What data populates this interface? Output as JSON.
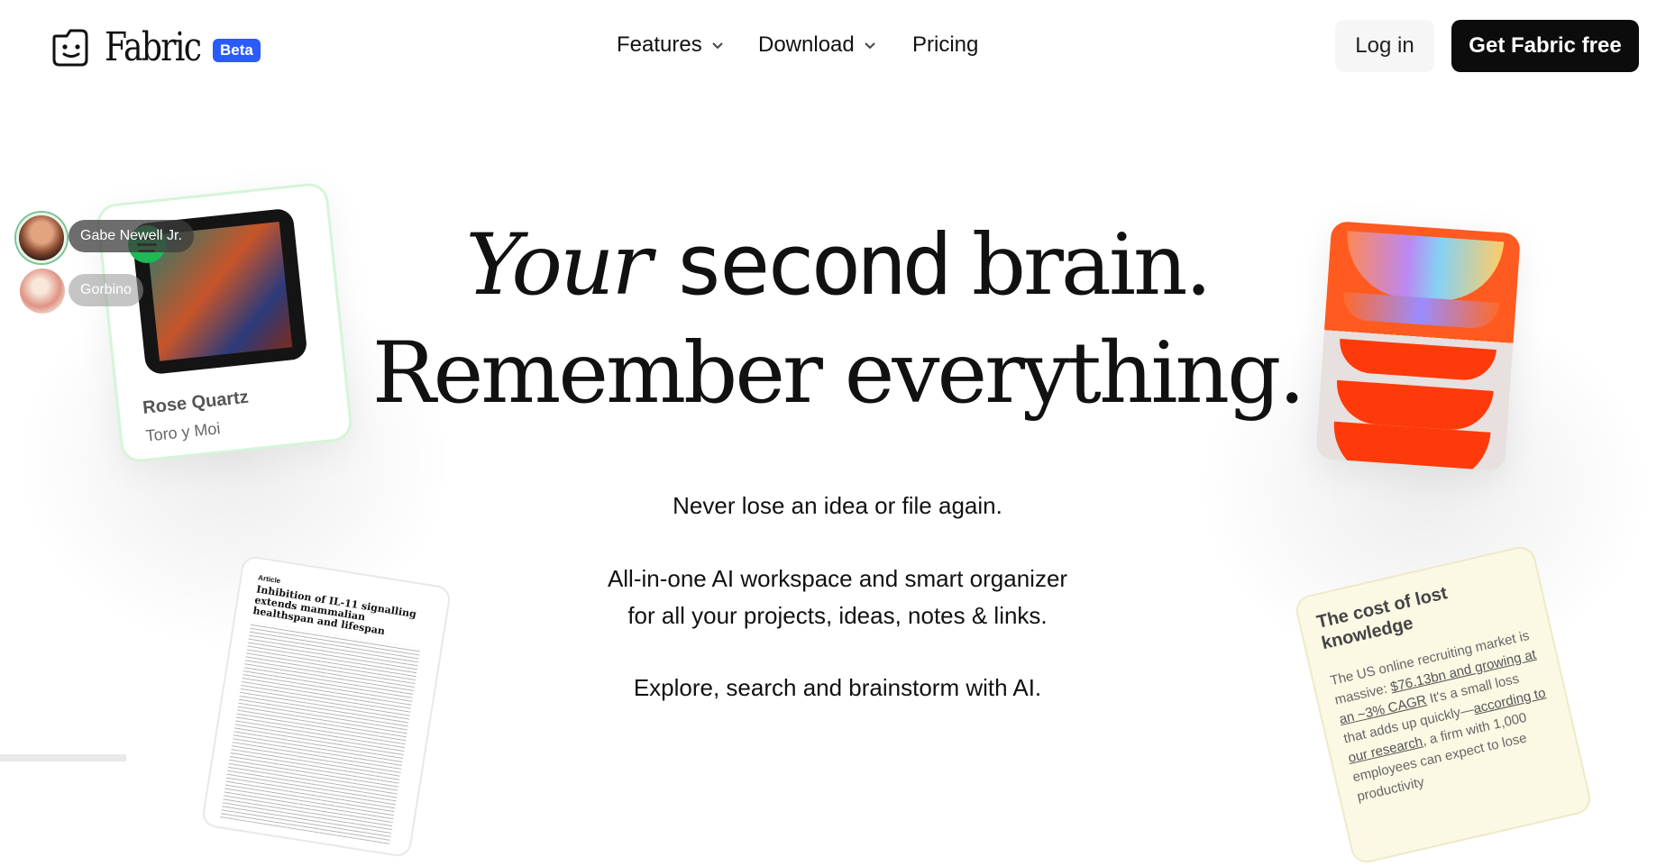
{
  "nav": {
    "logo_text": "Fabric",
    "beta_badge": "Beta",
    "menu": [
      {
        "label": "Features",
        "has_dropdown": true
      },
      {
        "label": "Download",
        "has_dropdown": true
      },
      {
        "label": "Pricing",
        "has_dropdown": false
      }
    ],
    "login_label": "Log in",
    "cta_label": "Get Fabric free"
  },
  "hero": {
    "line1_italic": "Your",
    "line1_pixel": "second",
    "line1_rest": "brain.",
    "line2": "Remember everything.",
    "sub1": "Never lose an idea or file again.",
    "sub2": "All-in-one AI workspace and smart organizer",
    "sub3": "for all your projects, ideas, notes & links.",
    "sub4": "Explore, search and brainstorm with AI."
  },
  "cards": {
    "album": {
      "title": "Rose Quartz",
      "artist": "Toro y Moi",
      "source_icon": "spotify-icon"
    },
    "collaborators": [
      {
        "name": "Gabe Newell Jr."
      },
      {
        "name": "Gorbino"
      }
    ],
    "paper": {
      "kicker": "Article",
      "title": "Inhibition of IL-11 signalling extends mammalian healthspan and lifespan"
    },
    "note": {
      "title": "The cost of lost knowledge",
      "body_1": "The US online recruiting market is massive: ",
      "link_1": "$76.13bn and growing at an ~3% CAGR",
      "body_2": " It's a small loss that adds up quickly—",
      "link_2": "according to our research",
      "body_3": ", a firm with 1,000 employees can expect to lose productivity"
    }
  },
  "colors": {
    "beta": "#2b5bff",
    "cta_bg": "#0c0c0c",
    "album_border": "#d5f5d8",
    "orange_card": "#ff5a1f",
    "note_bg": "#fbf8e4"
  }
}
